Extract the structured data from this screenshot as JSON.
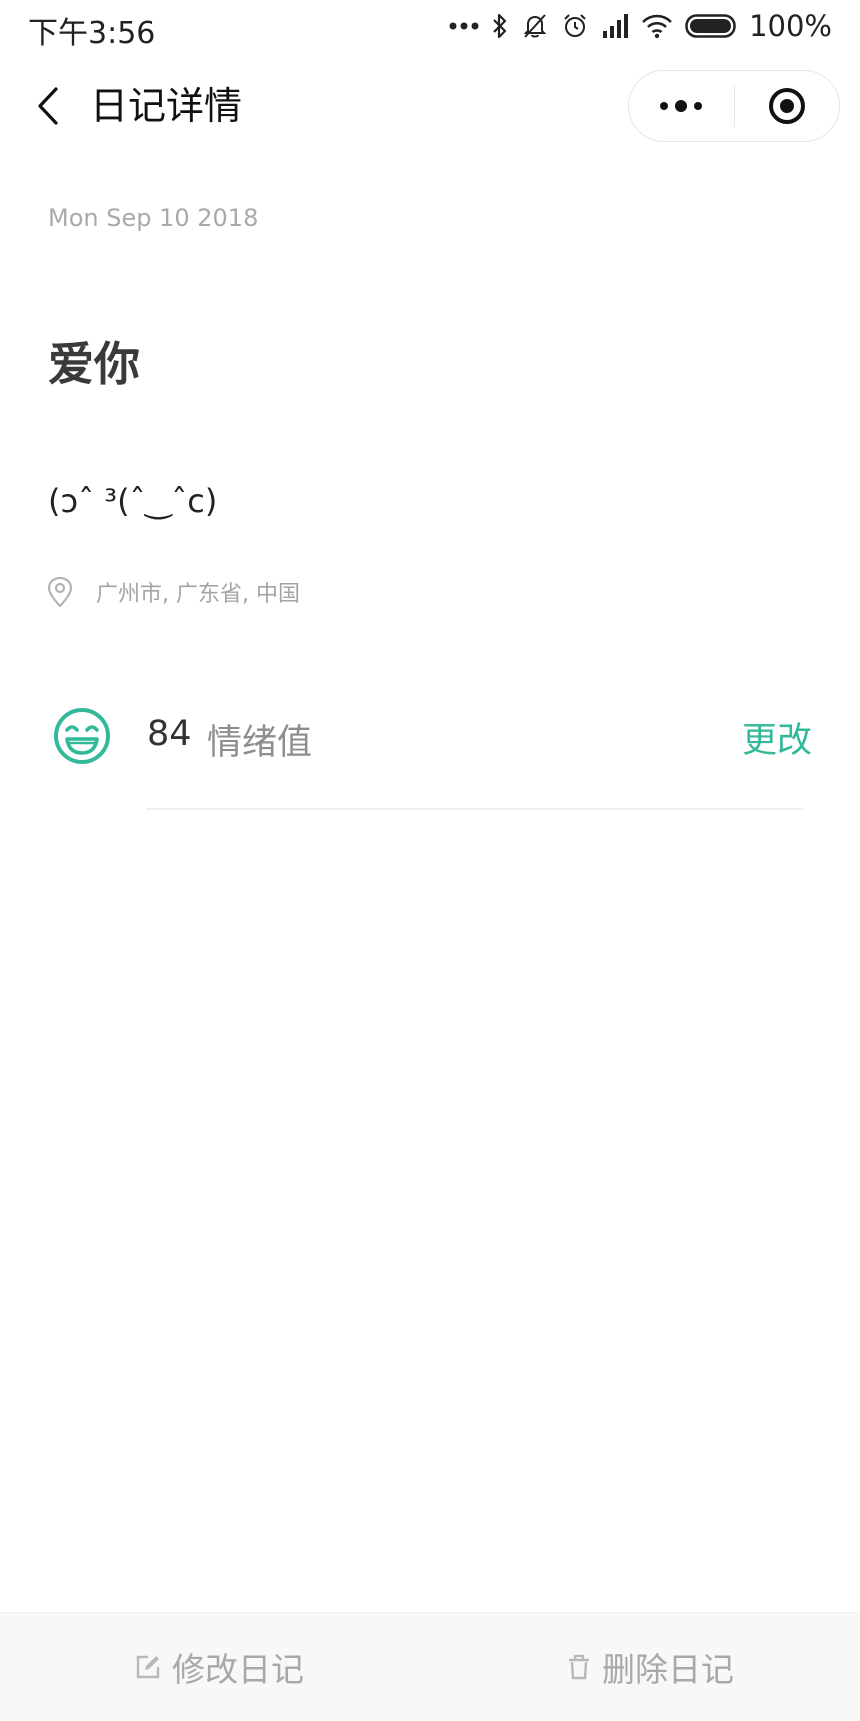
{
  "status_bar": {
    "time": "下午3:56",
    "battery": "100%"
  },
  "nav": {
    "title": "日记详情"
  },
  "diary": {
    "date": "Mon Sep 10 2018",
    "title": "爱你",
    "body": "(ↄˆ ³(ˆ‿ˆc)",
    "location": "广州市, 广东省, 中国"
  },
  "mood": {
    "value": "84",
    "label": "情绪值",
    "change": "更改",
    "color": "#33b99a"
  },
  "bottom_bar": {
    "edit_label": "修改日记",
    "delete_label": "删除日记"
  }
}
